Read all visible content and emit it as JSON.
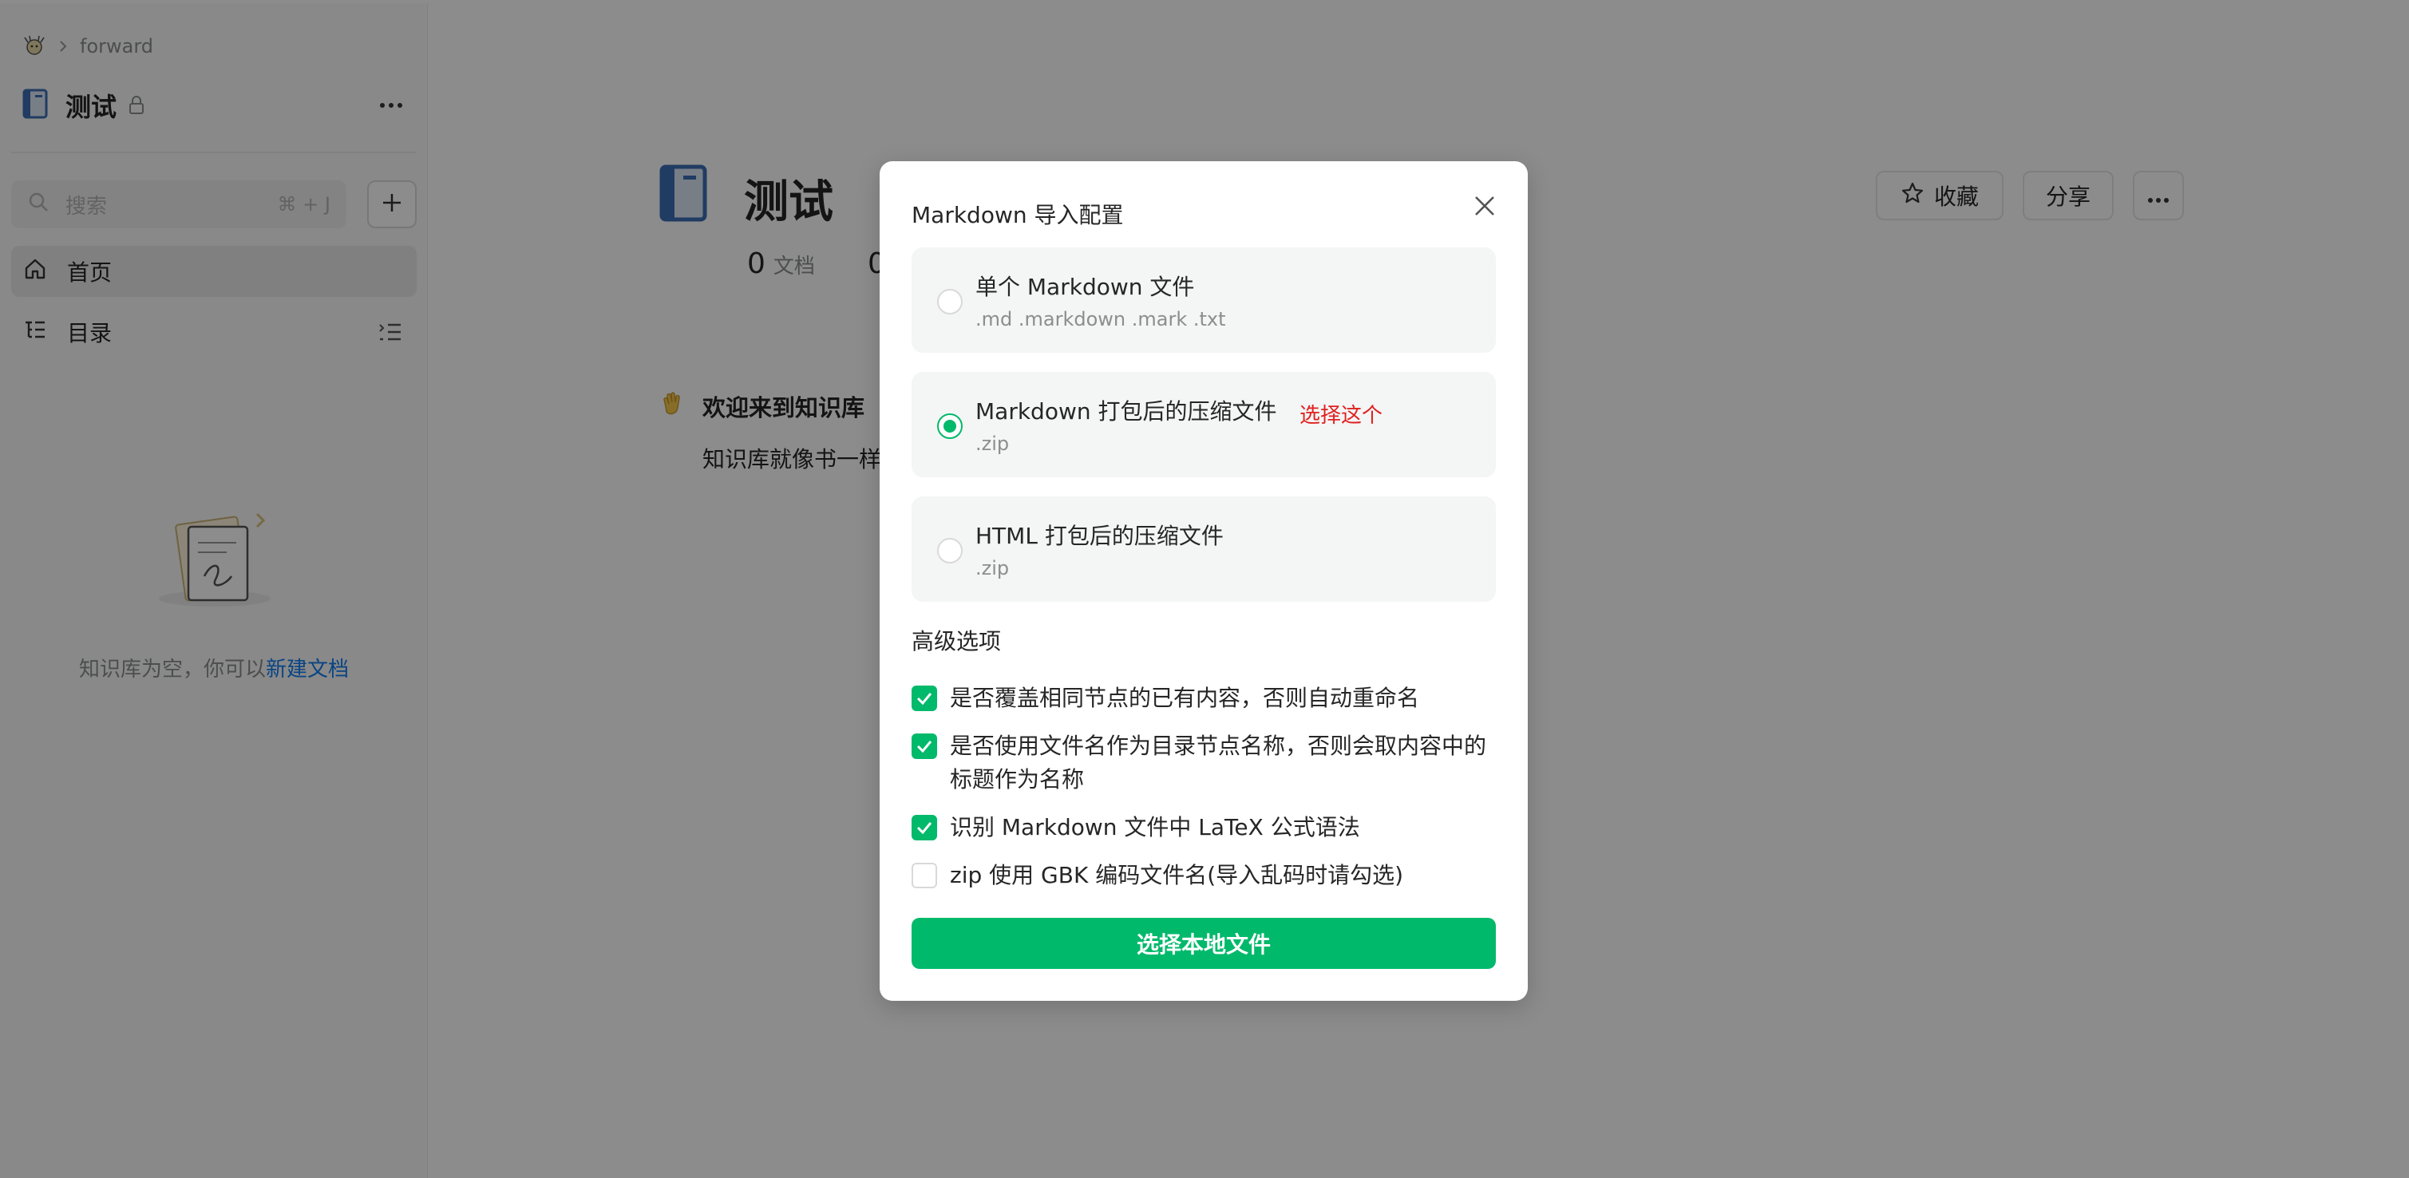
{
  "breadcrumb": {
    "org": "forward"
  },
  "sidebar": {
    "kb_title": "测试",
    "search_placeholder": "搜索",
    "search_shortcut": "⌘ + J",
    "nav": [
      {
        "label": "首页",
        "icon": "home-icon",
        "active": true
      },
      {
        "label": "目录",
        "icon": "toc-icon",
        "active": false
      }
    ],
    "empty_text": "知识库为空，你可以",
    "empty_link": "新建文档"
  },
  "main": {
    "title": "测试",
    "doc_count": "0",
    "doc_label": "文档",
    "second_count": "0",
    "favorite_label": "收藏",
    "share_label": "分享",
    "welcome_title": "欢迎来到知识库",
    "welcome_desc": "知识库就像书一样"
  },
  "modal": {
    "title": "Markdown 导入配置",
    "options": [
      {
        "title": "单个 Markdown 文件",
        "sub": ".md .markdown .mark .txt",
        "checked": false,
        "note": ""
      },
      {
        "title": "Markdown 打包后的压缩文件",
        "sub": ".zip",
        "checked": true,
        "note": "选择这个"
      },
      {
        "title": "HTML 打包后的压缩文件",
        "sub": ".zip",
        "checked": false,
        "note": ""
      }
    ],
    "advanced_title": "高级选项",
    "advanced": [
      {
        "label": "是否覆盖相同节点的已有内容，否则自动重命名",
        "checked": true
      },
      {
        "label": "是否使用文件名作为目录节点名称，否则会取内容中的标题作为名称",
        "checked": true
      },
      {
        "label": "识别 Markdown 文件中 LaTeX 公式语法",
        "checked": true
      },
      {
        "label": "zip 使用 GBK 编码文件名(导入乱码时请勾选)",
        "checked": false
      }
    ],
    "primary_button": "选择本地文件"
  },
  "colors": {
    "accent": "#00b96b",
    "note": "#e02020",
    "link": "#117cee"
  }
}
